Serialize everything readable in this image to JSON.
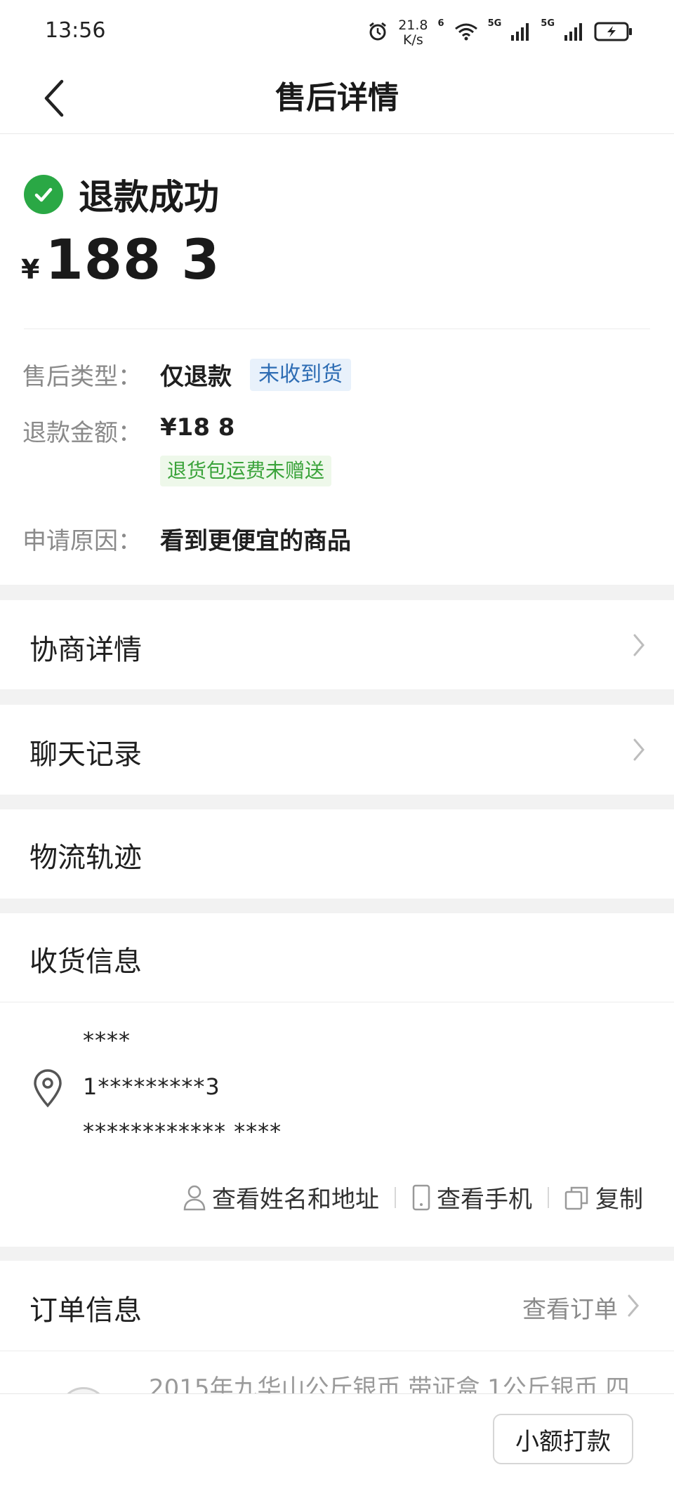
{
  "status_bar": {
    "time": "13:56",
    "net_speed_value": "21.8",
    "net_speed_unit": "K/s",
    "wifi_badge": "6",
    "sim1_label": "5G",
    "sim2_label": "5G"
  },
  "header": {
    "title": "售后详情"
  },
  "refund": {
    "status_text": "退款成功",
    "currency_symbol": "¥",
    "amount": "188 3",
    "fields": {
      "type_label": "售后类型：",
      "type_value": "仅退款",
      "type_tag": "未收到货",
      "amount_label": "退款金额：",
      "amount_value": "¥18  8",
      "amount_tag": "退货包运费未赠送",
      "reason_label": "申请原因：",
      "reason_value": "看到更便宜的商品"
    }
  },
  "sections": {
    "negotiation": "协商详情",
    "chat": "聊天记录",
    "logistics": "物流轨迹",
    "receiving": "收货信息"
  },
  "address": {
    "name": "****",
    "phone": "1*********3",
    "address": "************ ****",
    "view_name_address": "查看姓名和地址",
    "view_phone": "查看手机",
    "copy": "复制"
  },
  "order": {
    "title": "订单信息",
    "view_order": "查看订单",
    "product_title": "2015年九华山公斤银币 带证盒 1公斤银币 四"
  },
  "footer": {
    "small_payment_button": "小额打款"
  },
  "colors": {
    "success_green": "#2aa845",
    "tag_blue": "#2e6db4",
    "tag_green": "#3aa33a"
  }
}
